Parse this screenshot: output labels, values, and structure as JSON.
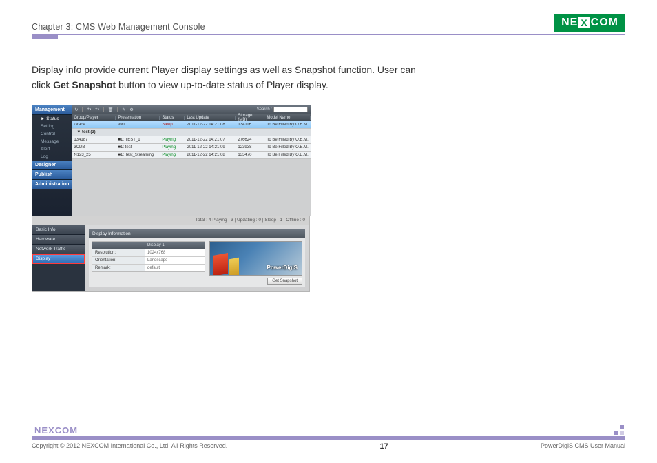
{
  "header": {
    "chapter_title": "Chapter 3: CMS Web Management Console",
    "logo_pre": "NE",
    "logo_x": "X",
    "logo_post": "COM"
  },
  "intro": {
    "text_1": "Display info provide current Player display settings as well as Snapshot function. User can click ",
    "bold": "Get Snapshot",
    "text_2": " button to view up-to-date status of Player display."
  },
  "screenshot": {
    "sidebar": {
      "management": "Management",
      "sub": {
        "status": "► Status",
        "setting": "Setting",
        "control": "Control",
        "message": "Message",
        "alert": "Alert",
        "log": "Log"
      },
      "designer": "Designer",
      "publish": "Publish",
      "administration": "Administration"
    },
    "toolbar": {
      "search_label": "Search :",
      "search_placeholder": ""
    },
    "columns": {
      "c1": "Group/Player",
      "c2": "Presentation",
      "c3": "Status",
      "c4": "Last Update",
      "c5": "Storage (MB)",
      "c6": "Model Name"
    },
    "group_row": {
      "name": "Grace",
      "pres": ">>1",
      "status": "Sleep",
      "last": "2011-12-22 14:21:08",
      "storage": "134116",
      "model": "To Be Filled By O.E.M."
    },
    "group2_label": "▼ test (3)",
    "rows": [
      {
        "name": "134187",
        "pres": "■1: TEST_1",
        "status": "Playing",
        "last": "2011-12-22 14:21:07",
        "storage": "276624",
        "model": "To Be Filled By O.E.M."
      },
      {
        "name": "3CDB",
        "pres": "■1: test",
        "status": "Playing",
        "last": "2011-12-22 14:21:09",
        "storage": "123938",
        "model": "To Be Filled By O.E.M."
      },
      {
        "name": "N123_25",
        "pres": "■1: Test_Streaming",
        "status": "Playing",
        "last": "2011-12-22 14:21:08",
        "storage": "133470",
        "model": "To Be Filled By O.E.M."
      }
    ],
    "status_line": "Total : 4   Playing : 3  |  Updating : 0  |  Sleep : 1  |  Offline : 0",
    "tabs": {
      "basic": "Basic Info",
      "hardware": "Hardware",
      "network": "Network Traffic",
      "display": "Display"
    },
    "detail": {
      "heading": "Display Information",
      "table_head_left": "",
      "table_head_right": "Display 1",
      "rows": [
        {
          "k": "Resolution:",
          "v": "1024x768"
        },
        {
          "k": "Orientation:",
          "v": "Landscape"
        },
        {
          "k": "Remark:",
          "v": "default"
        }
      ],
      "overlay_title": "PowerDigiS",
      "button": "Get Snapshot"
    }
  },
  "footer": {
    "logo_text": "NE COM",
    "copyright": "Copyright © 2012 NEXCOM International Co., Ltd. All Rights Reserved.",
    "page_number": "17",
    "manual_name": "PowerDigiS CMS User Manual"
  }
}
